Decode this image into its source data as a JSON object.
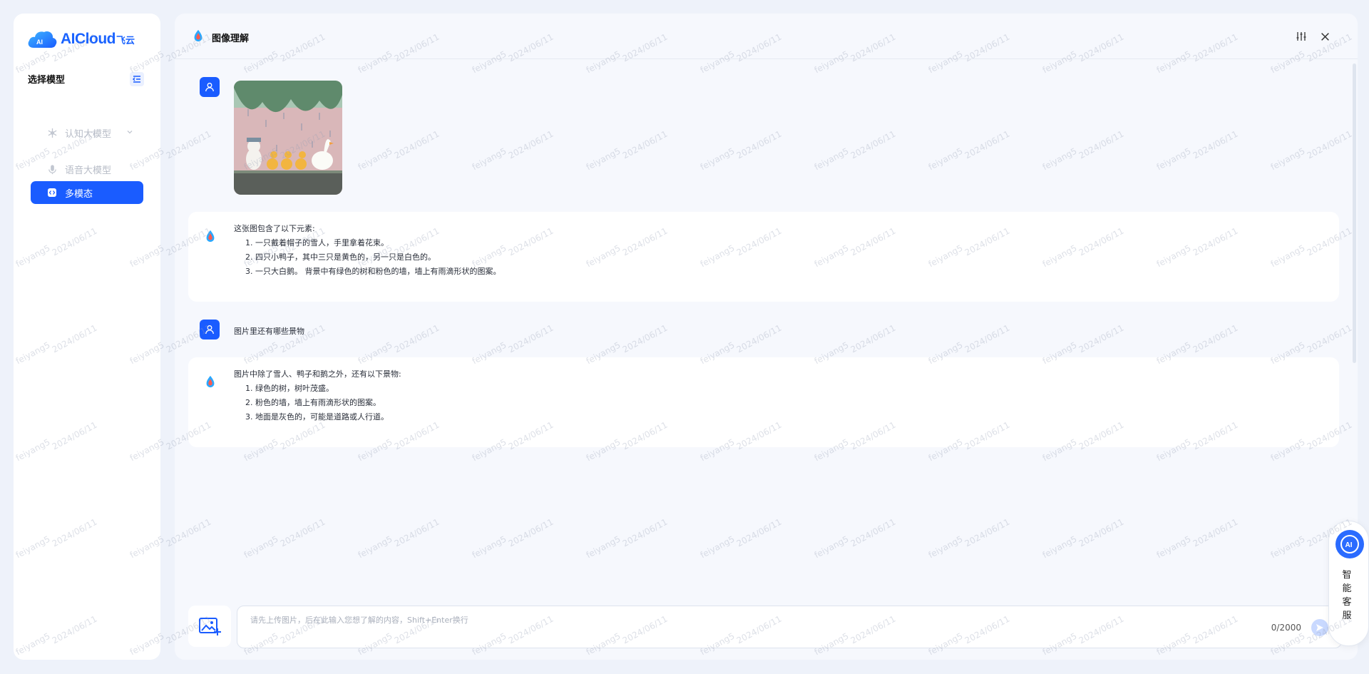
{
  "brand": {
    "logo_text": "AICloud",
    "logo_cn": "飞云",
    "cloud_label": "AI"
  },
  "colors": {
    "accent": "#1a5cff",
    "bg": "#eef2fa",
    "panel": "#f6f8fd"
  },
  "sidebar": {
    "title": "选择模型",
    "items": [
      {
        "label": "认知大模型",
        "icon": "snowflake-icon",
        "active": false,
        "has_chevron": true
      },
      {
        "label": "语音大模型",
        "icon": "microphone-icon",
        "active": false
      },
      {
        "label": "多模态",
        "icon": "code-icon",
        "active": true
      }
    ]
  },
  "header": {
    "title": "图像理解"
  },
  "conversation": {
    "answer1": {
      "intro": "这张图包含了以下元素:",
      "items": [
        "一只戴着帽子的雪人，手里拿着花束。",
        "四只小鸭子，其中三只是黄色的，另一只是白色的。",
        "一只大白鹅。 背景中有绿色的树和粉色的墙，墙上有雨滴形状的图案。"
      ]
    },
    "question2": "图片里还有哪些景物",
    "answer2": {
      "intro": "图片中除了雪人、鸭子和鹅之外，还有以下景物:",
      "items": [
        "绿色的树，树叶茂盛。",
        "粉色的墙，墙上有雨滴形状的图案。",
        "地面是灰色的，可能是道路或人行道。"
      ]
    }
  },
  "input": {
    "placeholder": "请先上传图片，后在此输入您想了解的内容，Shift+Enter换行",
    "counter": "0/2000"
  },
  "assistant": {
    "label": "智能客服",
    "icon_text": "AI"
  },
  "watermark": {
    "name": "feiyang5",
    "date": "2024/06/11"
  }
}
